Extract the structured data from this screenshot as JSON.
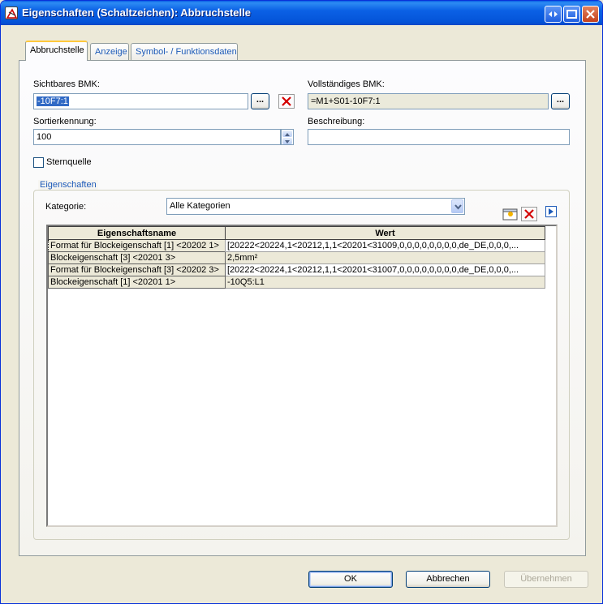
{
  "window": {
    "title": "Eigenschaften (Schaltzeichen): Abbruchstelle"
  },
  "tabs": [
    {
      "label": "Abbruchstelle",
      "active": true
    },
    {
      "label": "Anzeige",
      "active": false
    },
    {
      "label": "Symbol- / Funktionsdaten",
      "active": false
    }
  ],
  "form": {
    "sichtbares_bmk_label": "Sichtbares BMK:",
    "sichtbares_bmk_value": "-10F7:1",
    "vollstaendiges_bmk_label": "Vollständiges BMK:",
    "vollstaendiges_bmk_value": "=M1+S01-10F7:1",
    "sortierkennung_label": "Sortierkennung:",
    "sortierkennung_value": "100",
    "beschreibung_label": "Beschreibung:",
    "beschreibung_value": "",
    "sternquelle_label": "Sternquelle",
    "sternquelle_checked": false,
    "browse_label": "..."
  },
  "eigenschaften": {
    "group_title": "Eigenschaften",
    "kategorie_label": "Kategorie:",
    "kategorie_value": "Alle Kategorien",
    "columns": [
      "Eigenschaftsname",
      "Wert"
    ],
    "rows": [
      {
        "name": "Format für Blockeigenschaft [1] <20202 1>",
        "value": "[20222<20224,1<20212,1,1<20201<31009,0,0,0,0,0,0,0,0,de_DE,0,0,0,..."
      },
      {
        "name": "Blockeigenschaft [3] <20201 3>",
        "value": "2,5mm²"
      },
      {
        "name": "Format für Blockeigenschaft [3] <20202 3>",
        "value": "[20222<20224,1<20212,1,1<20201<31007,0,0,0,0,0,0,0,0,de_DE,0,0,0,..."
      },
      {
        "name": "Blockeigenschaft [1] <20201 1>",
        "value": "-10Q5:L1"
      }
    ]
  },
  "buttons": {
    "ok": "OK",
    "abbrechen": "Abbrechen",
    "uebernehmen": "Übernehmen"
  },
  "colors": {
    "titlebar": "#0a5fe5",
    "dialog_bg": "#ece9d8",
    "tab_accent": "#ffc83c",
    "delete_red": "#d40000"
  }
}
